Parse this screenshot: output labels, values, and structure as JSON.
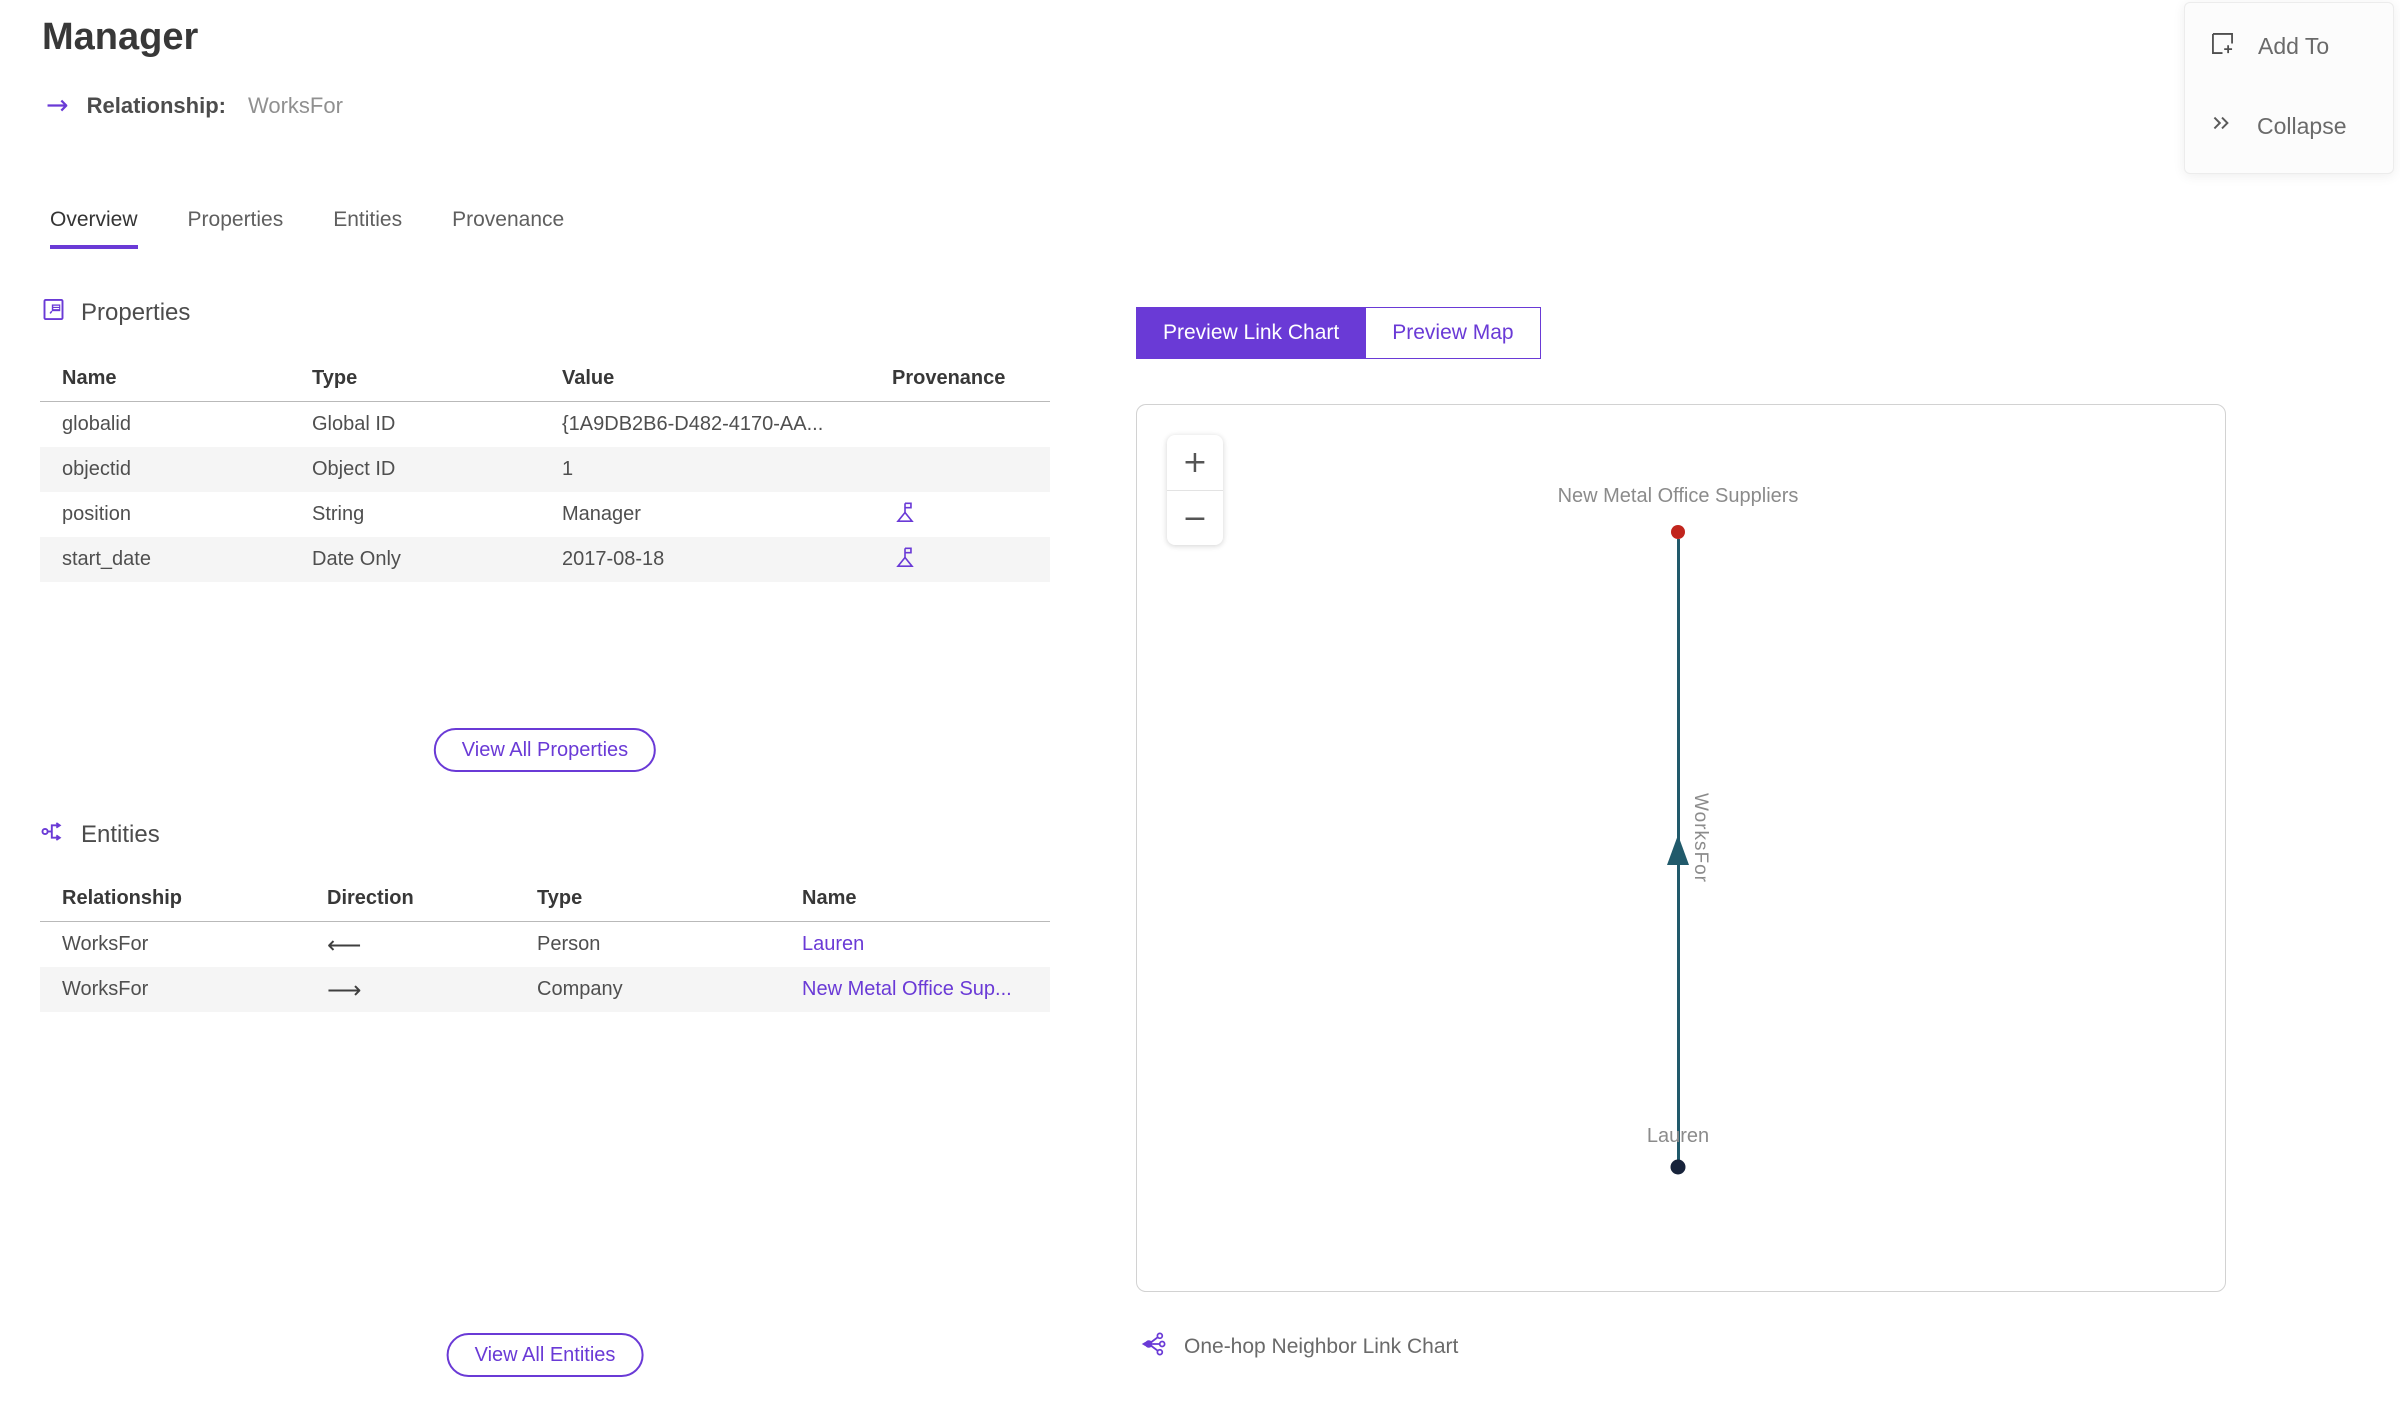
{
  "header": {
    "title": "Manager",
    "subtitle_label": "Relationship:",
    "subtitle_value": "WorksFor",
    "relationship_arrow": "→"
  },
  "actions": {
    "add_to": "Add To",
    "collapse": "Collapse"
  },
  "tabs": [
    {
      "label": "Overview"
    },
    {
      "label": "Properties"
    },
    {
      "label": "Entities"
    },
    {
      "label": "Provenance"
    }
  ],
  "properties_section": {
    "title": "Properties",
    "columns": [
      "Name",
      "Type",
      "Value",
      "Provenance"
    ],
    "rows": [
      {
        "name": "globalid",
        "type": "Global ID",
        "value": "{1A9DB2B6-D482-4170-AA...",
        "provenance": false
      },
      {
        "name": "objectid",
        "type": "Object ID",
        "value": "1",
        "provenance": false
      },
      {
        "name": "position",
        "type": "String",
        "value": "Manager",
        "provenance": true
      },
      {
        "name": "start_date",
        "type": "Date Only",
        "value": "2017-08-18",
        "provenance": true
      }
    ],
    "view_all_label": "View All Properties"
  },
  "entities_section": {
    "title": "Entities",
    "columns": [
      "Relationship",
      "Direction",
      "Type",
      "Name"
    ],
    "rows": [
      {
        "relationship": "WorksFor",
        "direction_glyph": "⟵",
        "type": "Person",
        "name": "Lauren"
      },
      {
        "relationship": "WorksFor",
        "direction_glyph": "⟶",
        "type": "Company",
        "name": "New Metal Office Sup..."
      }
    ],
    "view_all_label": "View All Entities"
  },
  "preview": {
    "tabs": [
      {
        "label": "Preview Link Chart",
        "active": true
      },
      {
        "label": "Preview Map",
        "active": false
      }
    ],
    "zoom_in": "+",
    "zoom_out": "−",
    "caption": "One-hop Neighbor Link Chart"
  },
  "link_chart": {
    "nodes": [
      {
        "label": "New Metal Office Suppliers",
        "color": "#c1251d"
      },
      {
        "label": "Lauren",
        "color": "#17233b"
      }
    ],
    "edge": {
      "label": "WorksFor",
      "color": "#215a6b",
      "direction": "toward New Metal Office Suppliers"
    }
  },
  "colors": {
    "accent": "#6a3ad6",
    "edge_teal": "#215a6b",
    "node_red": "#c1251d",
    "node_navy": "#17233b"
  }
}
